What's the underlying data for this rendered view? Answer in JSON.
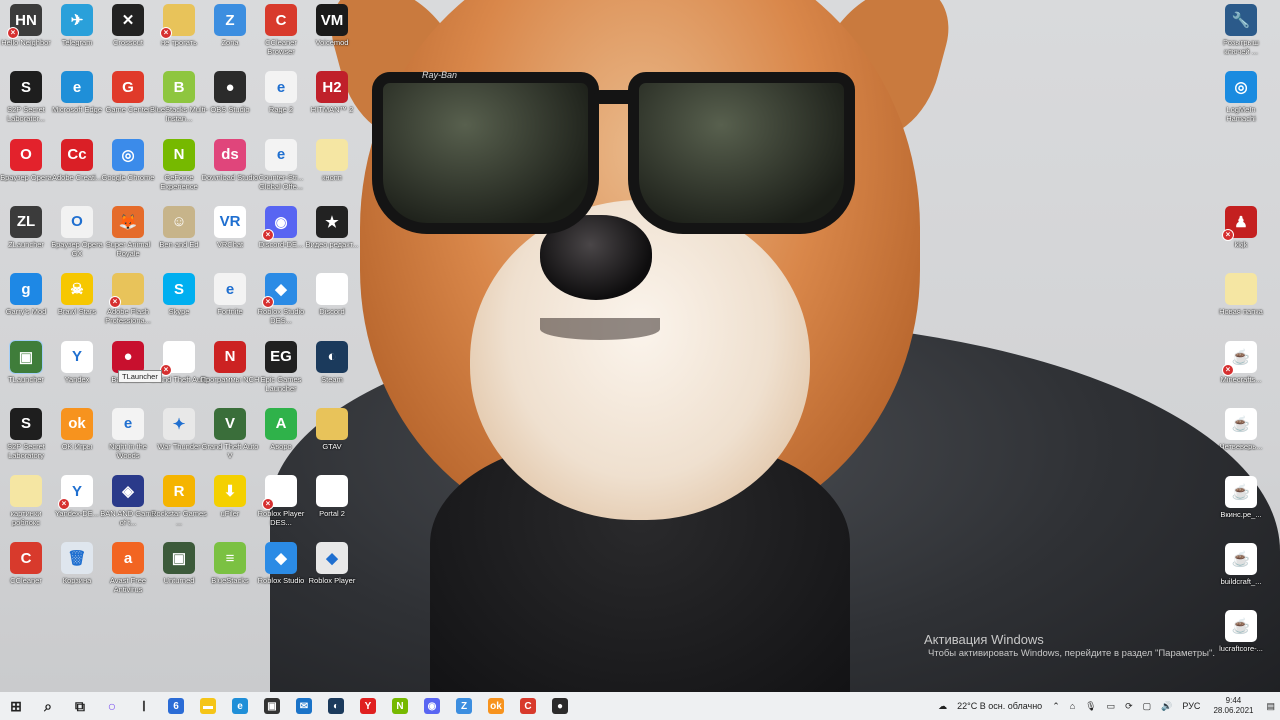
{
  "desktop_icons": [
    {
      "label": "Hello Neighbor",
      "icon": "hello-neighbor-icon",
      "color": "#3b3b3b",
      "glyph": "HN",
      "x": true
    },
    {
      "label": "Telegram",
      "icon": "telegram-icon",
      "color": "#2aa0da",
      "glyph": "✈"
    },
    {
      "label": "Crossout",
      "icon": "crossout-icon",
      "color": "#222222",
      "glyph": "✕"
    },
    {
      "label": "не трогать",
      "icon": "folder-icon",
      "color": "#e8c35a",
      "glyph": "",
      "x": true
    },
    {
      "label": "Zona",
      "icon": "zona-icon",
      "color": "#3c8ee0",
      "glyph": "Z"
    },
    {
      "label": "CCleaner Browser",
      "icon": "ccleaner-browser-icon",
      "color": "#d83a2c",
      "glyph": "C"
    },
    {
      "label": "Voicemod",
      "icon": "voicemod-icon",
      "color": "#1a1a1a",
      "glyph": "VM"
    },
    {
      "label": "S2P Secret Laborator...",
      "icon": "s2p-icon",
      "color": "#1e1e1e",
      "glyph": "S"
    },
    {
      "label": "Microsoft Edge",
      "icon": "edge-icon",
      "color": "#1f8fd8",
      "glyph": "e"
    },
    {
      "label": "Game Center",
      "icon": "game-center-icon",
      "color": "#e03a2a",
      "glyph": "G"
    },
    {
      "label": "BlueStacks Multi-Instan...",
      "icon": "bluestacks-multi-icon",
      "color": "#8ec63f",
      "glyph": "B"
    },
    {
      "label": "OBS Studio",
      "icon": "obs-icon",
      "color": "#2b2b2b",
      "glyph": "●"
    },
    {
      "label": "Rage 2",
      "icon": "rage2-icon",
      "color": "#f3f3f3",
      "glyph": "e"
    },
    {
      "label": "HITMAN™ 2",
      "icon": "hitman2-icon",
      "color": "#c0202a",
      "glyph": "H2"
    },
    {
      "label": "Браузер Opera",
      "icon": "opera-icon",
      "color": "#e3222c",
      "glyph": "O"
    },
    {
      "label": "Adobe Creati...",
      "icon": "adobe-cc-icon",
      "color": "#da1f26",
      "glyph": "Cc"
    },
    {
      "label": "Google Chrome",
      "icon": "chrome-icon",
      "color": "#3b8bea",
      "glyph": "◎"
    },
    {
      "label": "GeForce Experience",
      "icon": "geforce-icon",
      "color": "#76b900",
      "glyph": "N"
    },
    {
      "label": "Download Studio",
      "icon": "download-studio-icon",
      "color": "#e0457b",
      "glyph": "ds"
    },
    {
      "label": "Counter-Str... Global Offe...",
      "icon": "csgo-icon",
      "color": "#f3f3f3",
      "glyph": "e"
    },
    {
      "label": "кнопп",
      "icon": "folder-icon",
      "color": "#f5e6a3",
      "glyph": ""
    },
    {
      "label": "ZLauncher",
      "icon": "zlauncher-icon",
      "color": "#3b3b3b",
      "glyph": "ZL"
    },
    {
      "label": "Браузер Opera GX",
      "icon": "opera-gx-icon",
      "color": "#f2f2f2",
      "glyph": "O"
    },
    {
      "label": "Super Animal Royale",
      "icon": "super-animal-royale-icon",
      "color": "#e56b2a",
      "glyph": "🦊"
    },
    {
      "label": "Ben and Ed",
      "icon": "ben-and-ed-icon",
      "color": "#c7b48a",
      "glyph": "☺"
    },
    {
      "label": "VRChat",
      "icon": "vrchat-icon",
      "color": "#ffffff",
      "glyph": "VR"
    },
    {
      "label": "Discord-DE...",
      "icon": "discord-icon",
      "color": "#5865f2",
      "glyph": "◉",
      "x": true
    },
    {
      "label": "Видео редакт...",
      "icon": "video-editor-icon",
      "color": "#222222",
      "glyph": "★"
    },
    {
      "label": "Garry's Mod",
      "icon": "garrys-mod-icon",
      "color": "#1e88e5",
      "glyph": "g"
    },
    {
      "label": "Brawl Stars",
      "icon": "brawl-stars-icon",
      "color": "#f6c700",
      "glyph": "☠"
    },
    {
      "label": "Adobe Flash Professiona...",
      "icon": "folder-icon",
      "color": "#e8c35a",
      "glyph": "",
      "x": true
    },
    {
      "label": "Skype",
      "icon": "skype-icon",
      "color": "#00aff0",
      "glyph": "S"
    },
    {
      "label": "Fortnite",
      "icon": "fortnite-icon",
      "color": "#f3f3f3",
      "glyph": "e"
    },
    {
      "label": "Roblox Studio DES...",
      "icon": "roblox-studio-icon",
      "color": "#2b8be5",
      "glyph": "◆",
      "x": true
    },
    {
      "label": "Discord",
      "icon": "file-icon",
      "color": "#ffffff",
      "glyph": ""
    },
    {
      "label": "TLauncher",
      "icon": "tlauncher-icon",
      "color": "#3f7d3a",
      "glyph": "▣"
    },
    {
      "label": "Yandex",
      "icon": "yandex-icon",
      "color": "#ffffff",
      "glyph": "Y"
    },
    {
      "label": "Bandicam",
      "icon": "bandicam-icon",
      "color": "#c8102e",
      "glyph": "●"
    },
    {
      "label": "Grand Theft Auto",
      "icon": "file-icon",
      "color": "#ffffff",
      "glyph": "",
      "x": true
    },
    {
      "label": "Программы NCH",
      "icon": "nch-icon",
      "color": "#cc2222",
      "glyph": "N"
    },
    {
      "label": "Epic Games Launcher",
      "icon": "epic-games-icon",
      "color": "#202020",
      "glyph": "EG"
    },
    {
      "label": "Steam",
      "icon": "steam-icon",
      "color": "#1b3a5c",
      "glyph": "◐"
    },
    {
      "label": "S2P Secret Laboratory",
      "icon": "s2p-icon",
      "color": "#1e1e1e",
      "glyph": "S"
    },
    {
      "label": "OK Игры",
      "icon": "ok-games-icon",
      "color": "#f7931e",
      "glyph": "ok"
    },
    {
      "label": "Night in the Woods",
      "icon": "night-in-the-woods-icon",
      "color": "#f3f3f3",
      "glyph": "e"
    },
    {
      "label": "War Thunder",
      "icon": "war-thunder-icon",
      "color": "#e8e8e8",
      "glyph": "✦"
    },
    {
      "label": "Grand Theft Auto V",
      "icon": "gta5-icon",
      "color": "#3a6e3a",
      "glyph": "V"
    },
    {
      "label": "Aворо",
      "icon": "aworo-icon",
      "color": "#2fb24a",
      "glyph": "A"
    },
    {
      "label": "GTAV",
      "icon": "folder-icon",
      "color": "#e8c35a",
      "glyph": ""
    },
    {
      "label": "картинки роблокс",
      "icon": "folder-icon",
      "color": "#f5e6a3",
      "glyph": ""
    },
    {
      "label": "Yandex-DE...",
      "icon": "yandex-icon",
      "color": "#ffffff",
      "glyph": "Y",
      "x": true
    },
    {
      "label": "BAN AND Game of t...",
      "icon": "game-icon",
      "color": "#2a3a8a",
      "glyph": "◈"
    },
    {
      "label": "Rockstar Games ...",
      "icon": "rockstar-icon",
      "color": "#f5b400",
      "glyph": "R"
    },
    {
      "label": "uFiler",
      "icon": "ufiler-icon",
      "color": "#f4d000",
      "glyph": "⬇"
    },
    {
      "label": "Roblox Player DES...",
      "icon": "file-icon",
      "color": "#ffffff",
      "glyph": "",
      "x": true
    },
    {
      "label": "Portal 2",
      "icon": "file-icon",
      "color": "#ffffff",
      "glyph": ""
    },
    {
      "label": "CCleaner",
      "icon": "ccleaner-icon",
      "color": "#d83a2c",
      "glyph": "C"
    },
    {
      "label": "Корзина",
      "icon": "recycle-bin-icon",
      "color": "#dfe6ee",
      "glyph": "🗑"
    },
    {
      "label": "Avast Free Antivirus",
      "icon": "avast-icon",
      "color": "#f26522",
      "glyph": "a"
    },
    {
      "label": "Unturned",
      "icon": "unturned-icon",
      "color": "#3c5a3a",
      "glyph": "▣"
    },
    {
      "label": "BlueStacks",
      "icon": "bluestacks-icon",
      "color": "#7bc142",
      "glyph": "≡"
    },
    {
      "label": "Roblox Studio",
      "icon": "roblox-studio-icon",
      "color": "#2b8be5",
      "glyph": "◆"
    },
    {
      "label": "Roblox Player",
      "icon": "roblox-player-icon",
      "color": "#e8e8e8",
      "glyph": "◆"
    }
  ],
  "right_icons": [
    {
      "label": "Розыгрыш ключей ...",
      "icon": "key-giveaway-icon",
      "color": "#2b5a8a",
      "glyph": "🔧"
    },
    {
      "label": "LogMeIn Hamachi",
      "icon": "hamachi-icon",
      "color": "#1a8be0",
      "glyph": "◎"
    },
    {
      "label": "kkjk",
      "icon": "amongus-icon",
      "color": "#c42020",
      "glyph": "♟",
      "x": true
    },
    {
      "label": "Новая папка",
      "icon": "folder-icon",
      "color": "#f5e6a3",
      "glyph": ""
    },
    {
      "label": "Minecrafts...",
      "icon": "java-icon",
      "color": "#ffffff",
      "glyph": "☕",
      "x": true
    },
    {
      "label": "Четвеверь...",
      "icon": "java-icon",
      "color": "#ffffff",
      "glyph": "☕"
    },
    {
      "label": "Вкинс.pe_...",
      "icon": "java-icon",
      "color": "#ffffff",
      "glyph": "☕"
    },
    {
      "label": "buildcraft_...",
      "icon": "java-icon",
      "color": "#ffffff",
      "glyph": "☕"
    },
    {
      "label": "lucraftcore-...",
      "icon": "java-icon",
      "color": "#ffffff",
      "glyph": "☕"
    }
  ],
  "tooltip": "TLauncher",
  "wallpaper": {
    "brand_text": "Ray-Ban"
  },
  "activation": {
    "title": "Активация Windows",
    "subtitle": "Чтобы активировать Windows, перейдите в раздел \"Параметры\"."
  },
  "taskbar": {
    "apps": [
      {
        "icon": "start-icon",
        "glyph": "⊞",
        "color": "#222222"
      },
      {
        "icon": "search-icon",
        "glyph": "⌕",
        "color": "#222222"
      },
      {
        "icon": "task-view-icon",
        "glyph": "⧉",
        "color": "#222222"
      },
      {
        "icon": "cortana-icon",
        "glyph": "○",
        "color": "#7a4ff0"
      },
      {
        "icon": "app-icon",
        "glyph": "Ⅰ",
        "color": "#444444"
      },
      {
        "icon": "file-app-icon",
        "glyph": "6",
        "color": "#2b6cd6"
      },
      {
        "icon": "file-explorer-icon",
        "glyph": "▬",
        "color": "#f5c518"
      },
      {
        "icon": "edge-icon",
        "glyph": "e",
        "color": "#1f8fd8"
      },
      {
        "icon": "store-icon",
        "glyph": "▣",
        "color": "#333333"
      },
      {
        "icon": "mail-icon",
        "glyph": "✉",
        "color": "#1a73c8"
      },
      {
        "icon": "steam-icon",
        "glyph": "◐",
        "color": "#1b3a5c"
      },
      {
        "icon": "yandex-icon",
        "glyph": "Y",
        "color": "#e02020"
      },
      {
        "icon": "geforce-icon",
        "glyph": "N",
        "color": "#76b900"
      },
      {
        "icon": "discord-icon",
        "glyph": "◉",
        "color": "#5865f2"
      },
      {
        "icon": "zona-icon",
        "glyph": "Z",
        "color": "#3c8ee0"
      },
      {
        "icon": "ok-games-icon",
        "glyph": "ok",
        "color": "#f7931e"
      },
      {
        "icon": "ccleaner-icon",
        "glyph": "C",
        "color": "#d83a2c"
      },
      {
        "icon": "obs-icon",
        "glyph": "●",
        "color": "#2b2b2b"
      }
    ],
    "weather": "22°C  В осн. облачно",
    "language": "РУС",
    "time": "9:44",
    "date": "28.06.2021"
  }
}
